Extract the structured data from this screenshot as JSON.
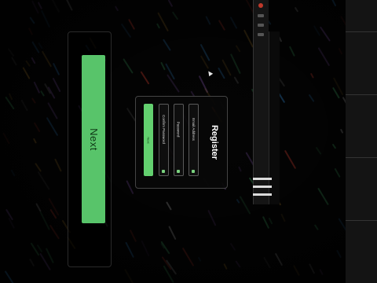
{
  "register": {
    "title": "Register",
    "fields": [
      {
        "label": "Email Address",
        "icon": "mail-icon"
      },
      {
        "label": "Password",
        "icon": "lock-icon"
      },
      {
        "label": "Confirm Password",
        "icon": "lock-icon"
      }
    ],
    "next_label": "Next"
  },
  "preview": {
    "next_label": "Next"
  },
  "colors": {
    "accent": "#63d06f",
    "background": "#000000",
    "card_border": "#444444"
  }
}
